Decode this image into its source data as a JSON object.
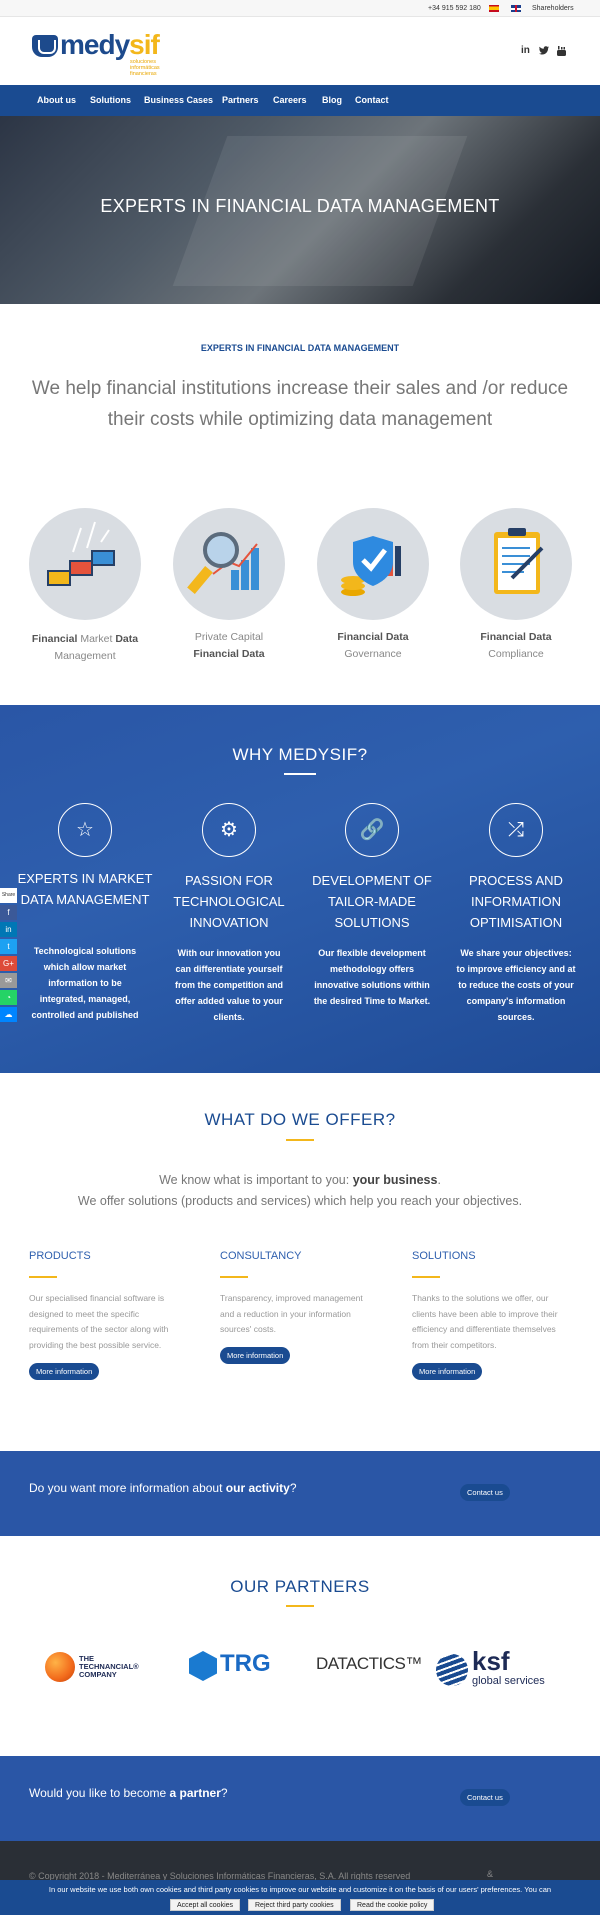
{
  "topbar": {
    "phone": "+34 915 592 180",
    "shareholders": "Shareholders"
  },
  "logo": {
    "word_a": "medy",
    "word_b": "sif",
    "tagline": "soluciones informáticas financieras"
  },
  "nav": [
    "About us",
    "Solutions",
    "Business Cases",
    "Partners",
    "Careers",
    "Blog",
    "Contact"
  ],
  "hero": {
    "title": "EXPERTS IN FINANCIAL DATA MANAGEMENT"
  },
  "intro": {
    "heading": "EXPERTS IN FINANCIAL DATA MANAGEMENT",
    "text": "We help financial institutions increase their sales and /or reduce their costs while optimizing data management"
  },
  "services": [
    {
      "l1_bold": "Financial",
      "l1_light": " Market ",
      "l1_bold2": "Data",
      "l2": "Management"
    },
    {
      "l1_light": "Private Capital",
      "l2_bold": "Financial Data"
    },
    {
      "l1_bold": "Financial Data",
      "l2": "Governance"
    },
    {
      "l1_bold": "Financial Data",
      "l2": "Compliance"
    }
  ],
  "why": {
    "heading": "WHY MEDYSIF?",
    "items": [
      {
        "title": "EXPERTS IN MARKET DATA MANAGEMENT",
        "desc": "Technological solutions which allow market information to be integrated, managed, controlled and published"
      },
      {
        "title": "PASSION FOR TECHNOLOGICAL INNOVATION",
        "desc": "With our innovation you can differentiate yourself from the competition and offer added value to your clients."
      },
      {
        "title": "DEVELOPMENT OF TAILOR-MADE SOLUTIONS",
        "desc": "Our flexible development methodology offers innovative solutions within the desired Time to Market."
      },
      {
        "title": "PROCESS AND INFORMATION OPTIMISATION",
        "desc": "We share your objectives: to improve efficiency and at to reduce the costs of your company's information sources."
      }
    ]
  },
  "share": {
    "label": "Share"
  },
  "offer": {
    "heading": "WHAT DO WE OFFER?",
    "line1_a": "We know what is important to you: ",
    "line1_b": "your business",
    "line1_c": ".",
    "line2": "We offer solutions (products and services) which help you reach your objectives.",
    "cols": [
      {
        "title": "PRODUCTS",
        "text": "Our specialised financial software is designed to meet the specific requirements of the sector along with providing the best possible service.",
        "button": "More information"
      },
      {
        "title": "CONSULTANCY",
        "text": "Transparency, improved management and a reduction in your information sources' costs.",
        "button": "More information"
      },
      {
        "title": "SOLUTIONS",
        "text": "Thanks to the solutions we offer, our clients have been able to improve their efficiency and differentiate themselves from their competitors.",
        "button": "More information"
      }
    ]
  },
  "band1": {
    "text_a": "Do you want more information about ",
    "text_b": "our activity",
    "text_c": "?",
    "button": "Contact us"
  },
  "partners": {
    "heading": "OUR PARTNERS",
    "logos": [
      {
        "l1": "THE",
        "l2": "TECHNANCIAL®",
        "l3": "COMPANY"
      },
      {
        "name": "TRG"
      },
      {
        "name": "DATACTICS™"
      },
      {
        "name": "ksf",
        "sub": "global services"
      }
    ]
  },
  "band2": {
    "text_a": "Would you like to become ",
    "text_b": "a partner",
    "text_c": "?",
    "button": "Contact us"
  },
  "footer": {
    "copyright": "© Copyright 2018 - Mediterránea y Soluciones Informáticas Financieras, S.A. All rights reserved"
  },
  "cookie": {
    "message": "In our website we use both own cookies and third party cookies to improve our website and customize it on the basis of our users' preferences. You can",
    "accept": "Accept all cookies",
    "reject": "Reject third party cookies",
    "policy": "Read the cookie policy"
  },
  "colors": {
    "brand_blue": "#1a4b91",
    "accent_yellow": "#f3b71b",
    "band_blue": "#2a56a6"
  }
}
